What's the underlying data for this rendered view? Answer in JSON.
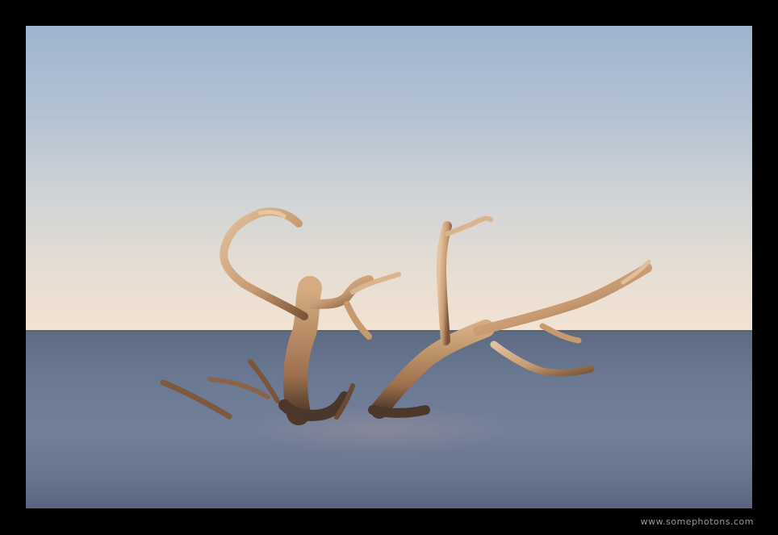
{
  "photo": {
    "subject": "driftwood-in-sea",
    "colors": {
      "frame": "#000000",
      "sky_top": "#9fb4cf",
      "sky_bottom": "#f2e3d3",
      "sea": "#6a7891",
      "wood_light": "#d9b48f",
      "wood_dark": "#6b4a32"
    }
  },
  "watermark": {
    "text": "www.somephotons.com"
  }
}
